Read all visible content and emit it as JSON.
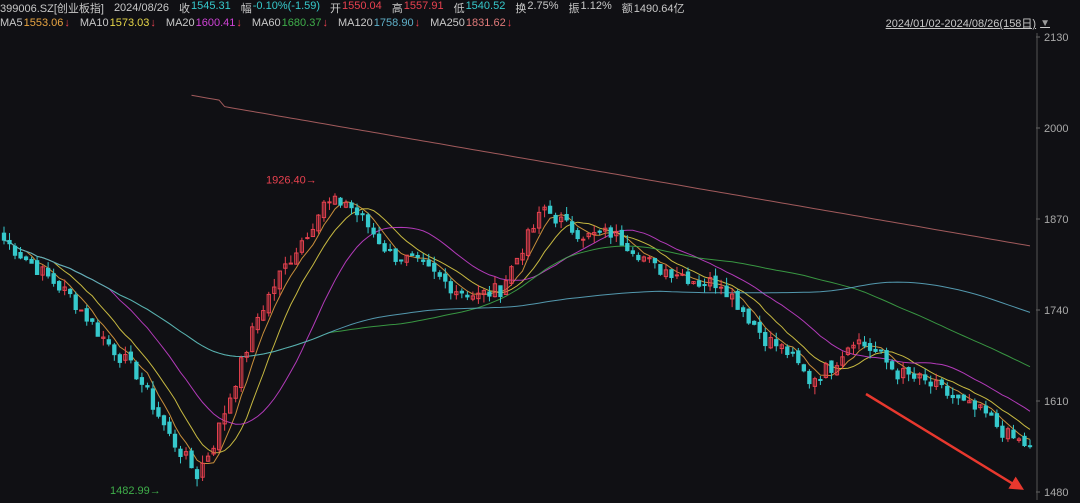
{
  "info": {
    "code": "399006.SZ[创业板指]",
    "date": "2024/08/26",
    "close_label": "收",
    "close": "1545.31",
    "change_label": "幅",
    "change": "-0.10%(-1.59)",
    "open_label": "开",
    "open": "1550.04",
    "high_label": "高",
    "high": "1557.91",
    "low_label": "低",
    "low": "1540.52",
    "turnover_label": "换",
    "turnover": "2.75%",
    "amplitude_label": "振",
    "amplitude": "1.12%",
    "amount_label": "额",
    "amount": "1490.64亿"
  },
  "ma": [
    {
      "label": "MA5",
      "value": "1553.06",
      "color": "#e8a542"
    },
    {
      "label": "MA10",
      "value": "1573.03",
      "color": "#e6d649"
    },
    {
      "label": "MA20",
      "value": "1600.41",
      "color": "#cf42d6"
    },
    {
      "label": "MA60",
      "value": "1680.37",
      "color": "#3fae4a"
    },
    {
      "label": "MA120",
      "value": "1758.90",
      "color": "#5fb0c9"
    },
    {
      "label": "MA250",
      "value": "1831.62",
      "color": "#e07a7a"
    }
  ],
  "date_range": "2024/01/02-2024/08/26(158日)",
  "dropdown_icon": "▼",
  "colors": {
    "up": "#e8414f",
    "down": "#36c9cc",
    "ma_down_arrow": "#e8414f",
    "arrow": "#e8382e"
  },
  "chart_data": {
    "type": "candlestick",
    "ylim": [
      1480,
      2130
    ],
    "yticks": [
      1480,
      1610,
      1740,
      1870,
      2000,
      2130
    ],
    "annotations": {
      "high": {
        "label": "1926.40→",
        "value": 1926.4
      },
      "low": {
        "label": "1482.99→",
        "value": 1482.99
      }
    },
    "trend_arrow": {
      "direction": "down",
      "from": 1620,
      "to": 1483
    }
  }
}
